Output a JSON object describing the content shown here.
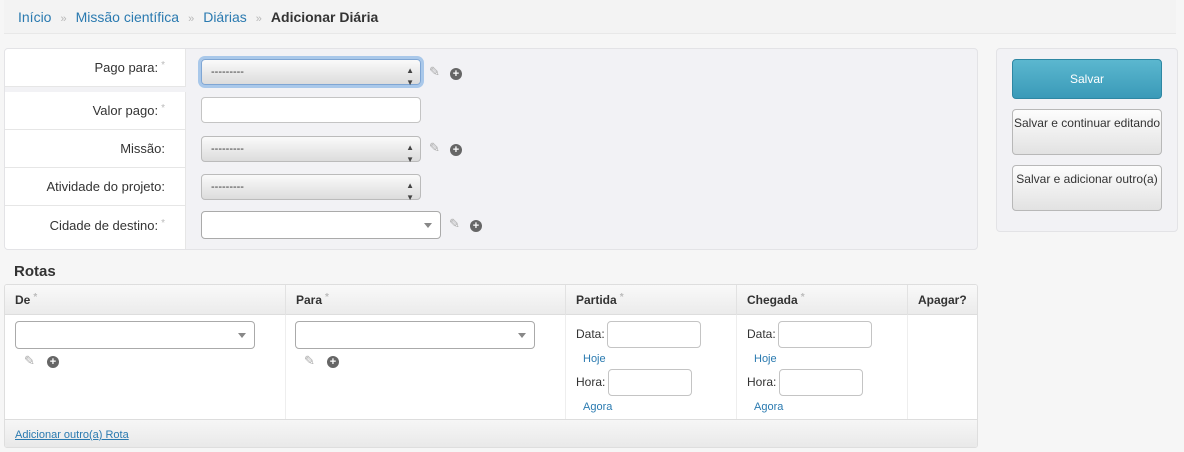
{
  "breadcrumb": {
    "items": [
      "Início",
      "Missão científica",
      "Diárias"
    ],
    "separator": "»",
    "current": "Adicionar Diária"
  },
  "form": {
    "required_mark": "*",
    "pago_para": {
      "label": "Pago para:",
      "value": "---------"
    },
    "valor_pago": {
      "label": "Valor pago:",
      "value": ""
    },
    "missao": {
      "label": "Missão:",
      "value": "---------"
    },
    "atividade": {
      "label": "Atividade do projeto:",
      "value": "---------"
    },
    "cidade_destino": {
      "label": "Cidade de destino:",
      "value": ""
    }
  },
  "actions": {
    "save": "Salvar",
    "save_continue": "Salvar e continuar editando",
    "save_add": "Salvar e adicionar outro(a)"
  },
  "rotas": {
    "title": "Rotas",
    "columns": [
      "De",
      "Para",
      "Partida",
      "Chegada",
      "Apagar?"
    ],
    "date_label": "Data:",
    "time_label": "Hora:",
    "today_link": "Hoje",
    "now_link": "Agora",
    "add_link": "Adicionar outro(a) Rota"
  },
  "icons": {
    "edit": "pencil-icon",
    "add": "plus-icon",
    "select_arrows": "updown-arrows-icon"
  },
  "colors": {
    "link": "#2a7ab0",
    "primary_button": "#4aa8c4",
    "focus_ring": "#a9c8ea"
  }
}
